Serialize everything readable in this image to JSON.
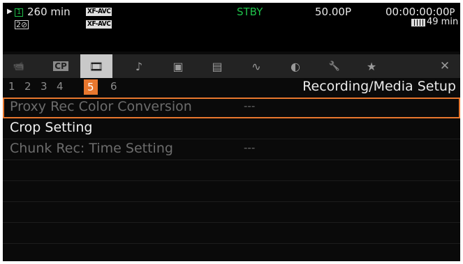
{
  "status": {
    "play_icon": "play-triangle-icon",
    "slot1": "1",
    "remaining": "260 min",
    "format1": "XF-AVC",
    "format2": "XF-AVC",
    "slot2_icon": "card-slot-2-icon",
    "mode": "STBY",
    "frame_rate": "50.00P",
    "timecode": "00:00:00:00",
    "tc_suffix": "P",
    "battery_icon": "battery-icon",
    "battery_time": "49 min"
  },
  "tabs": [
    {
      "name": "camera-tab",
      "icon": "movie-camera-icon",
      "glyph": "📹"
    },
    {
      "name": "cp-tab",
      "icon": "custom-picture-icon",
      "glyph": "CP"
    },
    {
      "name": "recording-setup-tab",
      "icon": "recording-setup-icon",
      "glyph": "🎞"
    },
    {
      "name": "audio-tab",
      "icon": "audio-icon",
      "glyph": "♪"
    },
    {
      "name": "video-setup-tab",
      "icon": "video-setup-icon",
      "glyph": "▣"
    },
    {
      "name": "lcd-setup-tab",
      "icon": "lcd-setup-icon",
      "glyph": "▤"
    },
    {
      "name": "assist-tab",
      "icon": "assist-functions-icon",
      "glyph": "∿"
    },
    {
      "name": "network-tab",
      "icon": "network-icon",
      "glyph": "◐"
    },
    {
      "name": "system-tab",
      "icon": "wrench-icon",
      "glyph": "🔧"
    },
    {
      "name": "my-menu-tab",
      "icon": "star-icon",
      "glyph": "★"
    },
    {
      "name": "close-tab",
      "icon": "close-icon",
      "glyph": "✕"
    }
  ],
  "pages": [
    "1",
    "2",
    "3",
    "4",
    "5",
    "6"
  ],
  "active_page": "5",
  "menu_title": "Recording/Media Setup",
  "rows": [
    {
      "label": "Proxy Rec Color Conversion",
      "value": "---"
    },
    {
      "label": "Crop Setting",
      "value": ""
    },
    {
      "label": "Chunk Rec: Time Setting",
      "value": "---"
    }
  ],
  "colors": {
    "accent": "#e8772e",
    "green": "#1fbf4a",
    "active_tab": "#c9c9c9"
  }
}
